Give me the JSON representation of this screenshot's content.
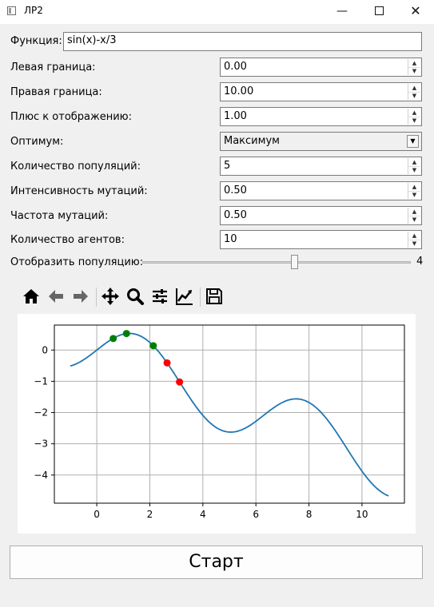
{
  "window": {
    "title": "ЛР2",
    "minimize": "—",
    "maximize": "",
    "close": "✕"
  },
  "function": {
    "label": "Функция:",
    "value": "sin(x)-x/3"
  },
  "params": [
    {
      "label": "Левая граница:",
      "value": "0.00"
    },
    {
      "label": "Правая граница:",
      "value": "10.00"
    },
    {
      "label": "Плюс к отображению:",
      "value": "1.00"
    }
  ],
  "optimum": {
    "label": "Оптимум:",
    "value": "Максимум",
    "options": [
      "Максимум"
    ]
  },
  "params2": [
    {
      "label": "Количество популяций:",
      "value": "5"
    },
    {
      "label": "Интенсивность мутаций:",
      "value": "0.50"
    },
    {
      "label": "Частота мутаций:",
      "value": "0.50"
    },
    {
      "label": "Количество агентов:",
      "value": "10"
    }
  ],
  "population": {
    "label": "Отобразить популяцию:",
    "value": "4",
    "min": 0,
    "max": 5,
    "current": 4
  },
  "toolbar": {
    "icons": [
      "home-icon",
      "back-icon",
      "forward-icon",
      "pan-icon",
      "zoom-icon",
      "configure-subplots-icon",
      "edit-axis-icon",
      "save-icon"
    ]
  },
  "chart_data": {
    "type": "line",
    "title": "",
    "xlabel": "",
    "ylabel": "",
    "xlim": [
      -1.6,
      11.6
    ],
    "ylim": [
      -4.9,
      0.8
    ],
    "xticks": [
      "0",
      "2",
      "4",
      "6",
      "8",
      "10"
    ],
    "yticks": [
      "0",
      "−1",
      "−2",
      "−3",
      "−4"
    ],
    "grid": true,
    "series": [
      {
        "function": "sin(x)-x/3",
        "x_range": [
          -1,
          11
        ],
        "color": "#1f77b4"
      }
    ],
    "points": [
      {
        "x": 0.62,
        "y": 0.37,
        "color": "#008000"
      },
      {
        "x": 1.12,
        "y": 0.53,
        "color": "#008000"
      },
      {
        "x": 2.13,
        "y": 0.14,
        "color": "#008000"
      },
      {
        "x": 2.65,
        "y": -0.41,
        "color": "#ff0000"
      },
      {
        "x": 3.12,
        "y": -1.02,
        "color": "#ff0000"
      }
    ]
  },
  "start": {
    "label": "Старт"
  }
}
